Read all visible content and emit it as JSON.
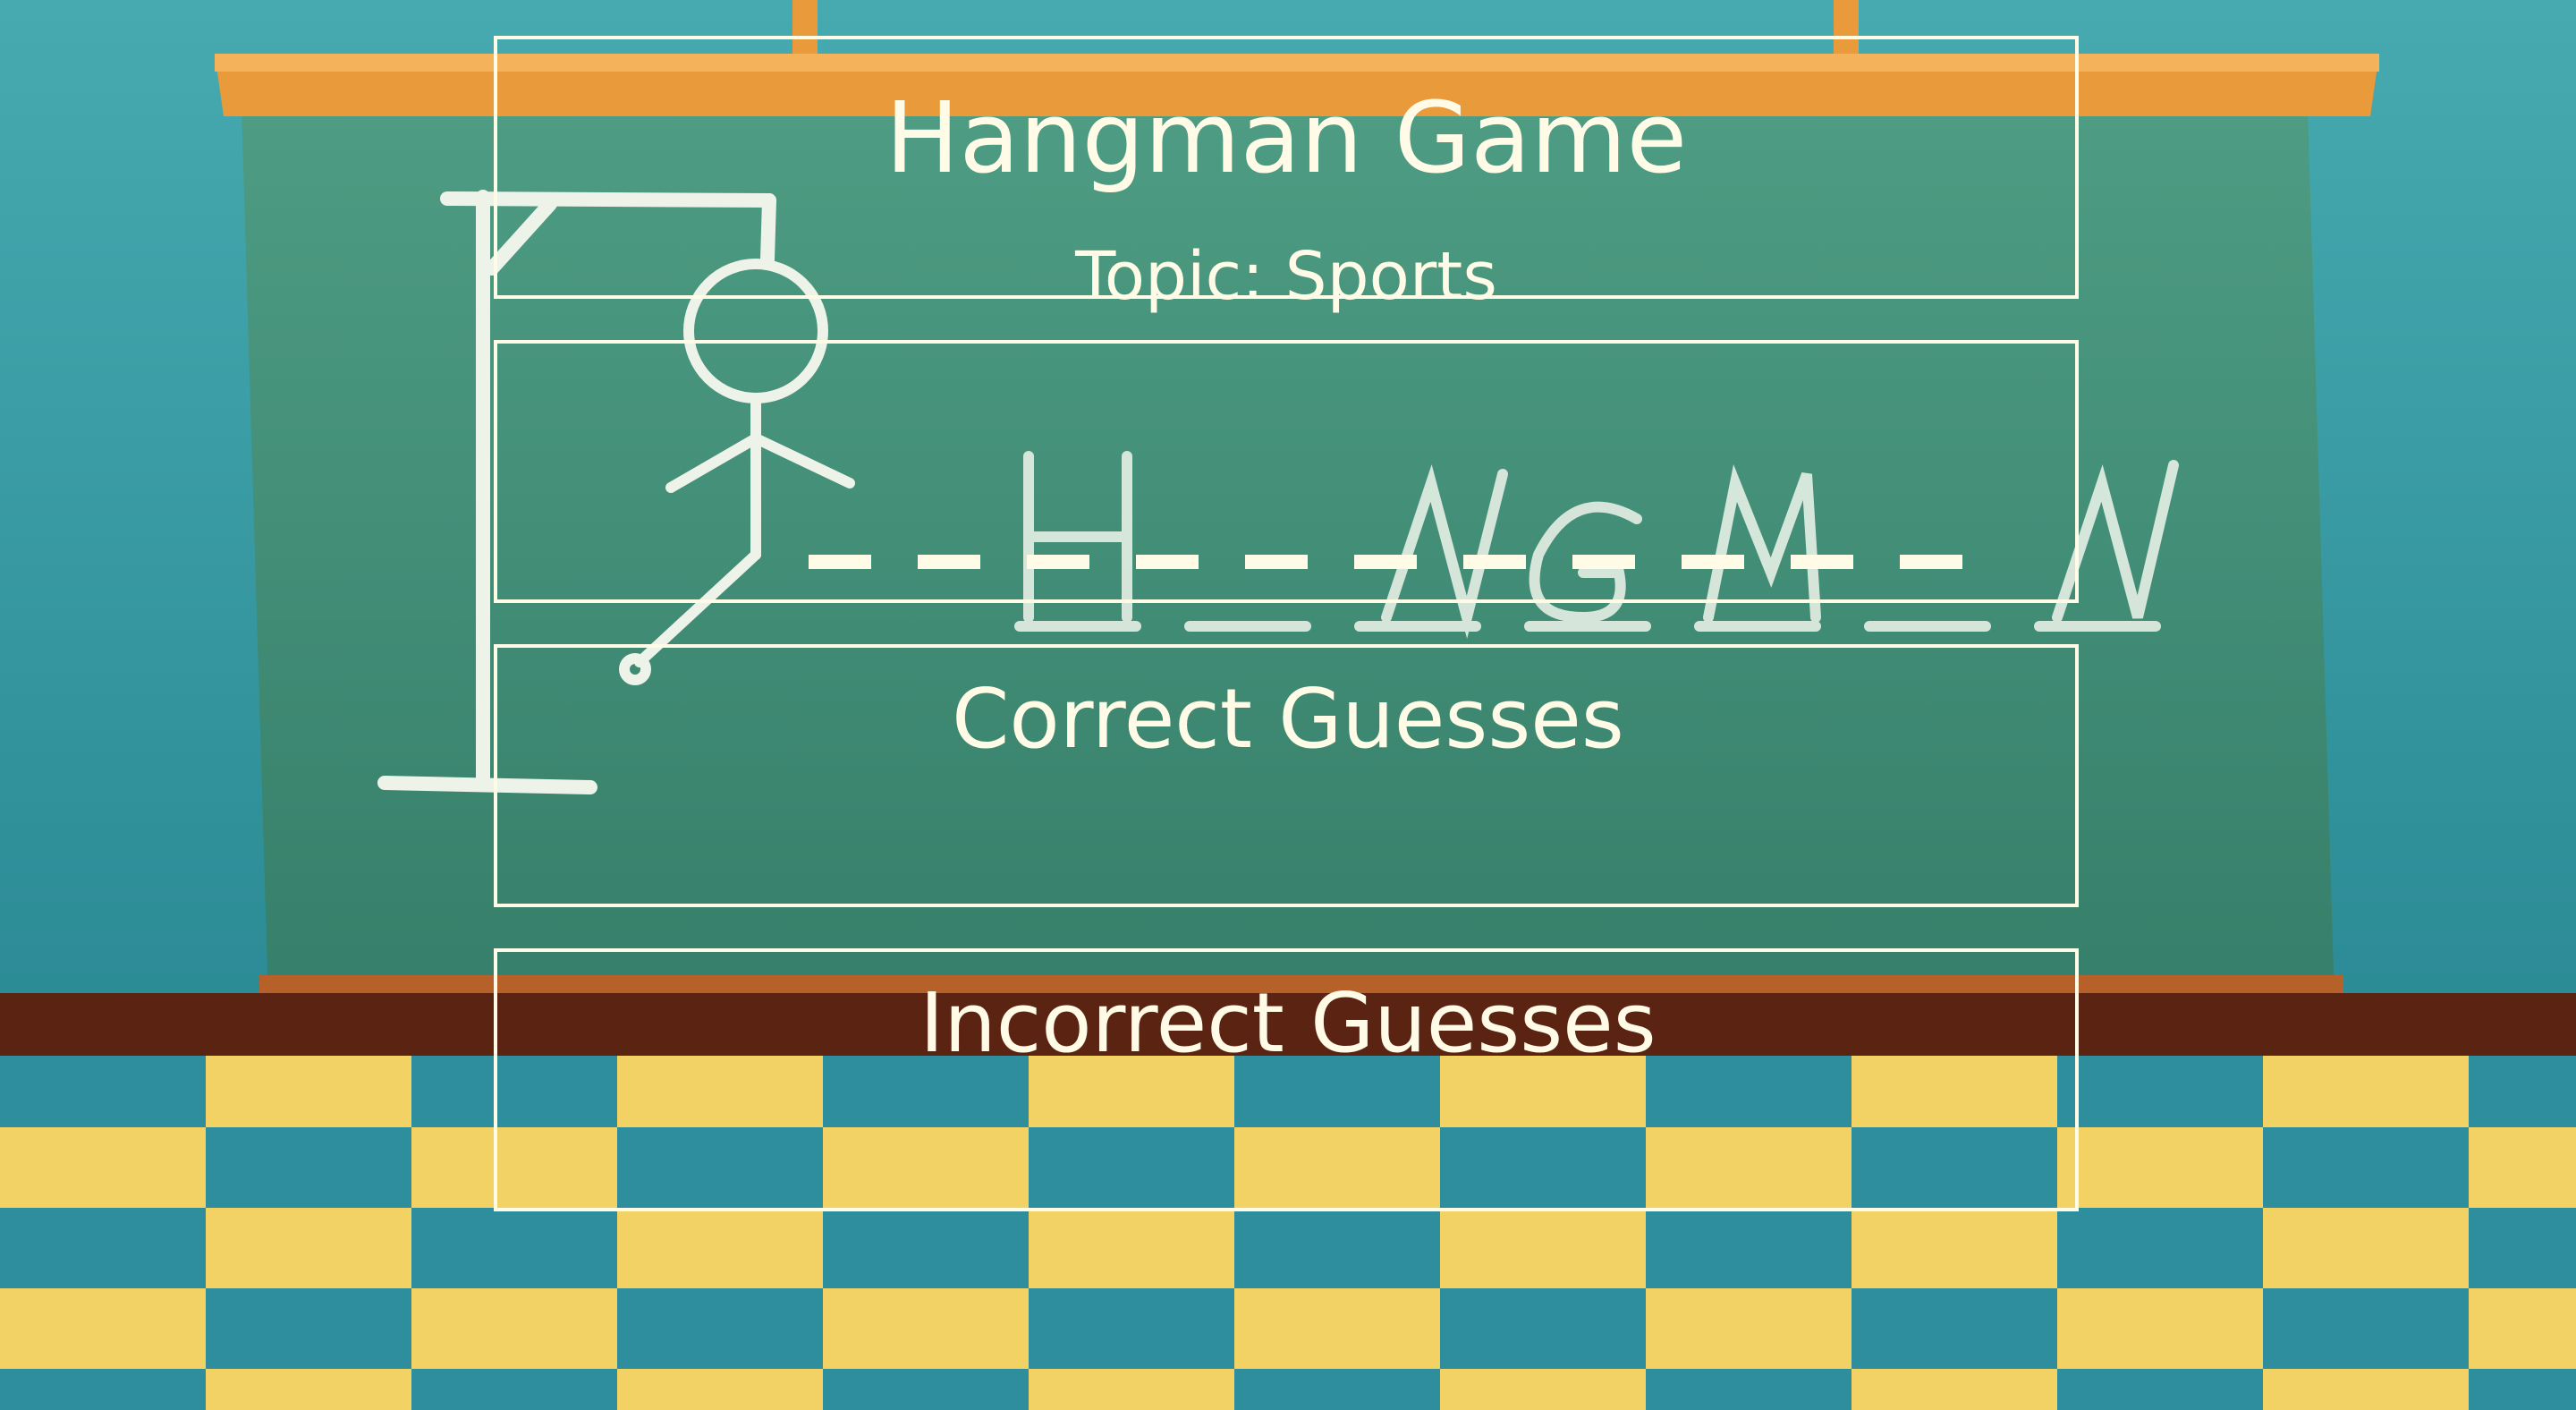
{
  "game": {
    "title": "Hangman Game",
    "topic_label": "Topic: Sports",
    "word_slots": 11,
    "correct_guesses_heading": "Correct Guesses",
    "correct_guesses": [],
    "incorrect_guesses_heading": "Incorrect Guesses",
    "incorrect_guesses": []
  },
  "background": {
    "chalkboard_word": "H A N G M A N",
    "colors": {
      "wall": "#3a9ea6",
      "board": "#3f8f78",
      "frame": "#e99a3b",
      "floor_yellow": "#f2d265",
      "floor_teal": "#2f8e9e",
      "chalk": "#fffbe6"
    }
  }
}
